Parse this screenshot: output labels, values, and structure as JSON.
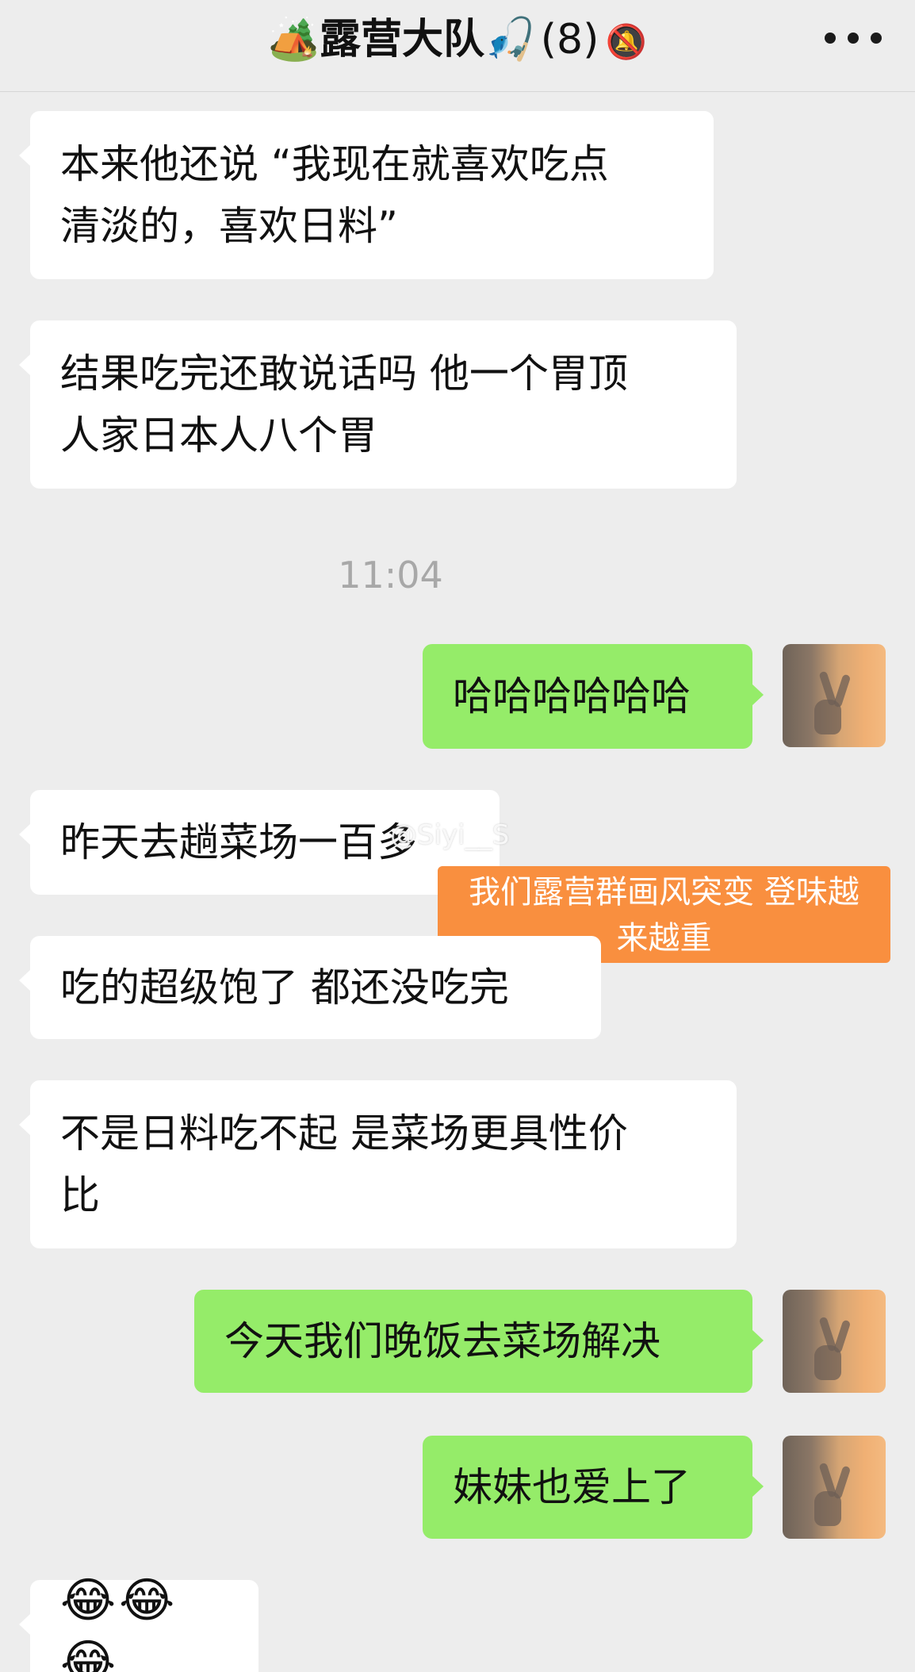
{
  "header": {
    "emoji_left": "🏕️",
    "name": "露营大队",
    "emoji_right": "🎣",
    "member_count": "(8)",
    "mute_icon": "bell-slash-icon",
    "more_icon": "more-dots-icon"
  },
  "messages": [
    {
      "direction": "in",
      "text": "本来他还说 “我现在就喜欢吃点\n清淡的，喜欢日料”"
    },
    {
      "direction": "in",
      "text": "结果吃完还敢说话吗 他一个胃顶\n人家日本人八个胃"
    },
    {
      "direction": "out",
      "text": "哈哈哈哈哈哈"
    },
    {
      "direction": "in",
      "text": "昨天去趟菜场一百多"
    },
    {
      "direction": "in",
      "text": "吃的超级饱了 都还没吃完"
    },
    {
      "direction": "in",
      "text": "不是日料吃不起 是菜场更具性价\n比"
    },
    {
      "direction": "out",
      "text": "今天我们晚饭去菜场解决"
    },
    {
      "direction": "out",
      "text": "妹妹也爱上了"
    },
    {
      "direction": "in",
      "text": "😂😂😂"
    }
  ],
  "timestamp": "11:04",
  "watermark": "@Siyi__S",
  "caption": {
    "line1": "我们露营群画风突变 登味越",
    "line2": "来越重"
  },
  "colors": {
    "background": "#ededed",
    "incoming_bubble": "#ffffff",
    "outgoing_bubble": "#95ec69",
    "caption_bg": "#f98f3f"
  }
}
